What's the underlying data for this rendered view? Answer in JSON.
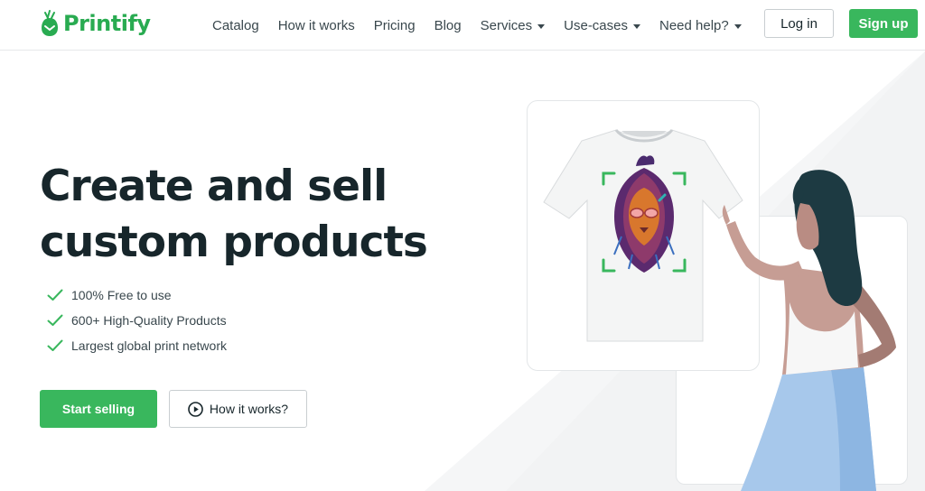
{
  "brand": {
    "name": "Printify",
    "color": "#29ab51"
  },
  "nav": {
    "items": [
      {
        "label": "Catalog",
        "dropdown": false
      },
      {
        "label": "How it works",
        "dropdown": false
      },
      {
        "label": "Pricing",
        "dropdown": false
      },
      {
        "label": "Blog",
        "dropdown": false
      },
      {
        "label": "Services",
        "dropdown": true
      },
      {
        "label": "Use-cases",
        "dropdown": true
      },
      {
        "label": "Need help?",
        "dropdown": true
      }
    ],
    "login_label": "Log in",
    "signup_label": "Sign up"
  },
  "hero": {
    "title_line1": "Create and sell",
    "title_line2": "custom products",
    "features": [
      "100% Free to use",
      "600+ High-Quality Products",
      "Largest global print network"
    ],
    "cta_primary": "Start selling",
    "cta_secondary": "How it works?"
  },
  "icons": {
    "feature": "check-icon",
    "secondary_cta": "play-circle-icon",
    "dropdown": "caret-down-icon"
  },
  "colors": {
    "accent": "#39b75d",
    "text": "#17262b",
    "muted": "#39474d"
  }
}
